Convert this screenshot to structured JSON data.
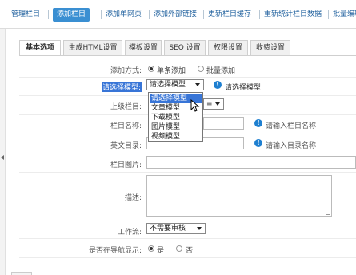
{
  "topnav": {
    "items": [
      "管理栏目",
      "添加栏目",
      "添加单网页",
      "添加外部链接",
      "更新栏目缓存",
      "重新统计栏目数据",
      "批量编辑"
    ]
  },
  "tabs": [
    "基本选项",
    "生成HTML设置",
    "模板设置",
    "SEO 设置",
    "权限设置",
    "收费设置"
  ],
  "form": {
    "add_mode": {
      "label": "添加方式:",
      "options": [
        "单条添加",
        "批量添加"
      ],
      "selected": "单条添加"
    },
    "model": {
      "label": "请选择模型:",
      "value": "请选择模型",
      "hint": "请选择模型"
    },
    "model_options": [
      "请选择模型",
      "文章模型",
      "下载模型",
      "图片模型",
      "视频模型"
    ],
    "parent": {
      "label": "上级栏目:"
    },
    "name": {
      "label": "栏目名称:",
      "hint": "请输入栏目名称"
    },
    "dir": {
      "label": "英文目录:",
      "hint": "请输入目录名称"
    },
    "image": {
      "label": "栏目图片:"
    },
    "description": {
      "label": "描述:"
    },
    "workflow": {
      "label": "工作流:",
      "value": "不需要审核"
    },
    "show_in_nav": {
      "label": "是否在导航显示:",
      "options": [
        "是",
        "否"
      ],
      "selected": "是"
    }
  },
  "icons": {
    "info": "info-icon",
    "cursor": "mouse-cursor-icon"
  },
  "colors": {
    "accent": "#3a8fd2",
    "link": "#1c5e9c",
    "info": "#1e7fd0",
    "highlight": "#3875d7"
  }
}
